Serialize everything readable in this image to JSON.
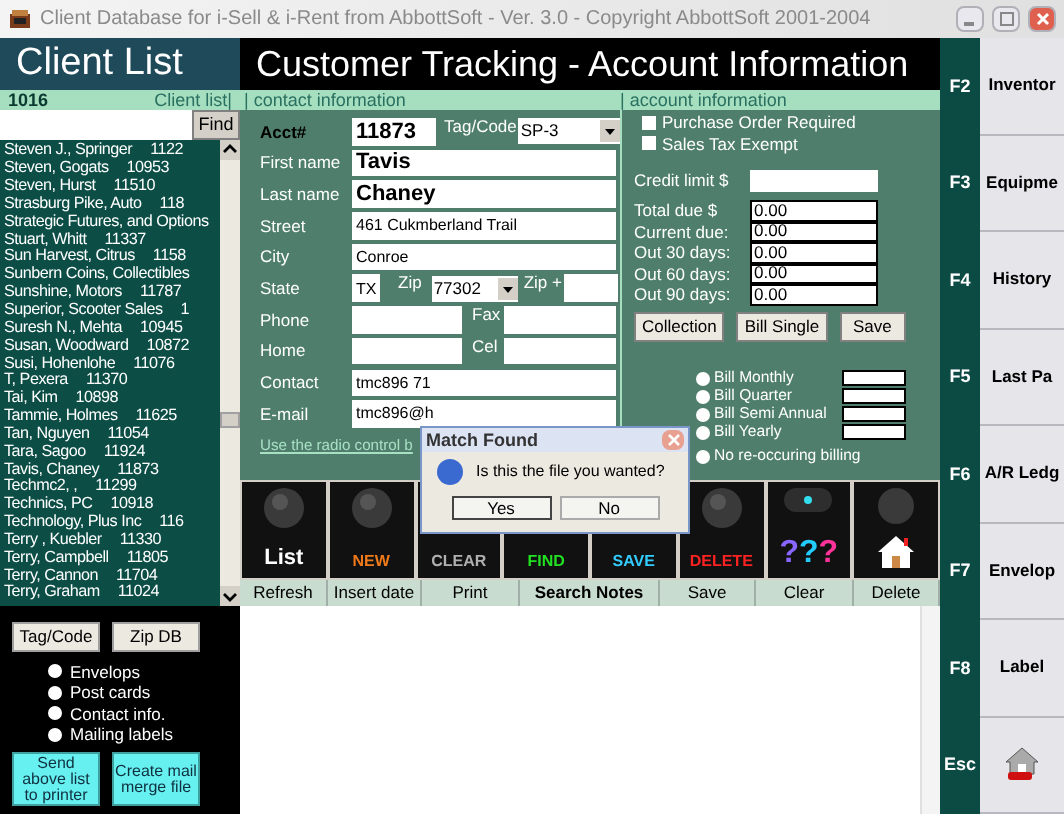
{
  "window": {
    "title": "Client Database for i-Sell & i-Rent from AbbottSoft - Ver. 3.0 - Copyright AbbottSoft 2001-2004",
    "active": false
  },
  "client_list": {
    "title": "Client List",
    "count": "1016",
    "tab": "Client list|",
    "find_button": "Find",
    "rows": [
      {
        "name": "Steven J., Springer",
        "id": "1122"
      },
      {
        "name": "Steven, Gogats",
        "id": "10953"
      },
      {
        "name": "Steven, Hurst",
        "id": "11510"
      },
      {
        "name": "Strasburg Pike, Auto",
        "id": "118"
      },
      {
        "name": "Strategic Futures, and Options"
      },
      {
        "name": "Stuart, Whitt",
        "id": "11337"
      },
      {
        "name": "Sun Harvest, Citrus",
        "id": "1158"
      },
      {
        "name": "Sunbern Coins, Collectibles"
      },
      {
        "name": "Sunshine, Motors",
        "id": "11787"
      },
      {
        "name": "Superior, Scooter Sales",
        "id": "1"
      },
      {
        "name": "Suresh N., Mehta",
        "id": "10945"
      },
      {
        "name": "Susan, Woodward",
        "id": "10872"
      },
      {
        "name": "Susi, Hohenlohe",
        "id": "11076"
      },
      {
        "name": "T, Pexera",
        "id": "11370"
      },
      {
        "name": "Tai, Kim",
        "id": "10898"
      },
      {
        "name": "Tammie, Holmes",
        "id": "11625"
      },
      {
        "name": "Tan, Nguyen",
        "id": "11054"
      },
      {
        "name": "Tara, Sagoo",
        "id": "11924"
      },
      {
        "name": "Tavis, Chaney",
        "id": "11873"
      },
      {
        "name": "Techmc2, ,",
        "id": "11299"
      },
      {
        "name": "Technics, PC",
        "id": "10918"
      },
      {
        "name": "Technology, Plus Inc",
        "id": "116"
      },
      {
        "name": "Terry , Kuebler",
        "id": "11330"
      },
      {
        "name": "Terry, Campbell",
        "id": "11805"
      },
      {
        "name": "Terry, Cannon",
        "id": "11704"
      },
      {
        "name": "Terry, Graham",
        "id": "11024"
      }
    ],
    "buttons": [
      "Tag/Code",
      "Zip DB"
    ],
    "output_options": [
      {
        "label": "Envelops",
        "selected": false
      },
      {
        "label": "Post cards",
        "selected": false
      },
      {
        "label": "Contact info.",
        "selected": false
      },
      {
        "label": "Mailing labels",
        "selected": false
      }
    ],
    "actions": [
      "Send above list to printer",
      "Create mail merge file"
    ]
  },
  "main": {
    "title": "Customer Tracking - Account Information",
    "contact_tab": "| contact information",
    "account_tab": "| account information",
    "contact": {
      "acct_label": "Acct#",
      "acct": "11873",
      "tag_label": "Tag/Code",
      "tag": "SP-3",
      "first_label": "First name",
      "first": "Tavis",
      "last_label": "Last name",
      "last": "Chaney",
      "street_label": "Street",
      "street": "461 Cukmberland Trail",
      "city_label": "City",
      "city": "Conroe",
      "state_label": "State",
      "state": "TX",
      "zip_label": "Zip",
      "zip": "77302",
      "zip4_label": "Zip +",
      "phone_label": "Phone",
      "fax_label": "Fax",
      "home_label": "Home",
      "cel_label": "Cel",
      "contact_label": "Contact",
      "contact": "tmc896 71",
      "email_label": "E-mail",
      "email": "tmc896@h",
      "hint": "Use the radio control b"
    },
    "account": {
      "checks": [
        {
          "label": "Purchase Order Required",
          "checked": false
        },
        {
          "label": "Sales Tax Exempt",
          "checked": false
        }
      ],
      "credit_label": "Credit limit $",
      "dues": [
        {
          "label": "Total due $",
          "value": "0.00"
        },
        {
          "label": "Current due:",
          "value": "0.00"
        },
        {
          "label": "Out 30 days:",
          "value": "0.00"
        },
        {
          "label": "Out 60 days:",
          "value": "0.00"
        },
        {
          "label": "Out 90 days:",
          "value": "0.00"
        }
      ],
      "buttons": [
        "Collection",
        "Bill Single",
        "Save"
      ],
      "billing": [
        {
          "label": "Bill Monthly",
          "selected": false,
          "field": true
        },
        {
          "label": "Bill Quarter",
          "selected": false,
          "field": true
        },
        {
          "label": "Bill Semi Annual",
          "selected": false,
          "field": true
        },
        {
          "label": "Bill Yearly",
          "selected": false,
          "field": true
        },
        {
          "label": "No re-occuring billing",
          "selected": false,
          "field": false
        }
      ]
    },
    "tiles": [
      {
        "kind": "label",
        "label": "List",
        "color": "#ffffff",
        "knob": true
      },
      {
        "kind": "label",
        "label": "NEW",
        "color": "#f07a1a",
        "knob": true
      },
      {
        "kind": "label",
        "label": "CLEAR",
        "color": "#b0b0b0"
      },
      {
        "kind": "label",
        "label": "FIND",
        "color": "#22e022"
      },
      {
        "kind": "label",
        "label": "SAVE",
        "color": "#33ccff"
      },
      {
        "kind": "label",
        "label": "DELETE",
        "color": "#ff2222",
        "knob": true
      },
      {
        "kind": "help",
        "label": "???",
        "color": "#ff3399"
      },
      {
        "kind": "home",
        "color": "#ffffff"
      }
    ],
    "toolbar": [
      "Refresh",
      "Insert date",
      "Print",
      "Search Notes",
      "Save",
      "Clear",
      "Delete"
    ]
  },
  "function_keys": [
    {
      "key": "F2",
      "label": "Inventor"
    },
    {
      "key": "F3",
      "label": "Equipme"
    },
    {
      "key": "F4",
      "label": "History"
    },
    {
      "key": "F5",
      "label": "Last Pa"
    },
    {
      "key": "F6",
      "label": "A/R Ledg"
    },
    {
      "key": "F7",
      "label": "Envelop"
    },
    {
      "key": "F8",
      "label": "Label"
    },
    {
      "key": "Esc",
      "kind": "home"
    }
  ],
  "dialog": {
    "title": "Match Found",
    "message": "Is this the file you wanted?",
    "buttons": [
      "Yes",
      "No"
    ]
  }
}
